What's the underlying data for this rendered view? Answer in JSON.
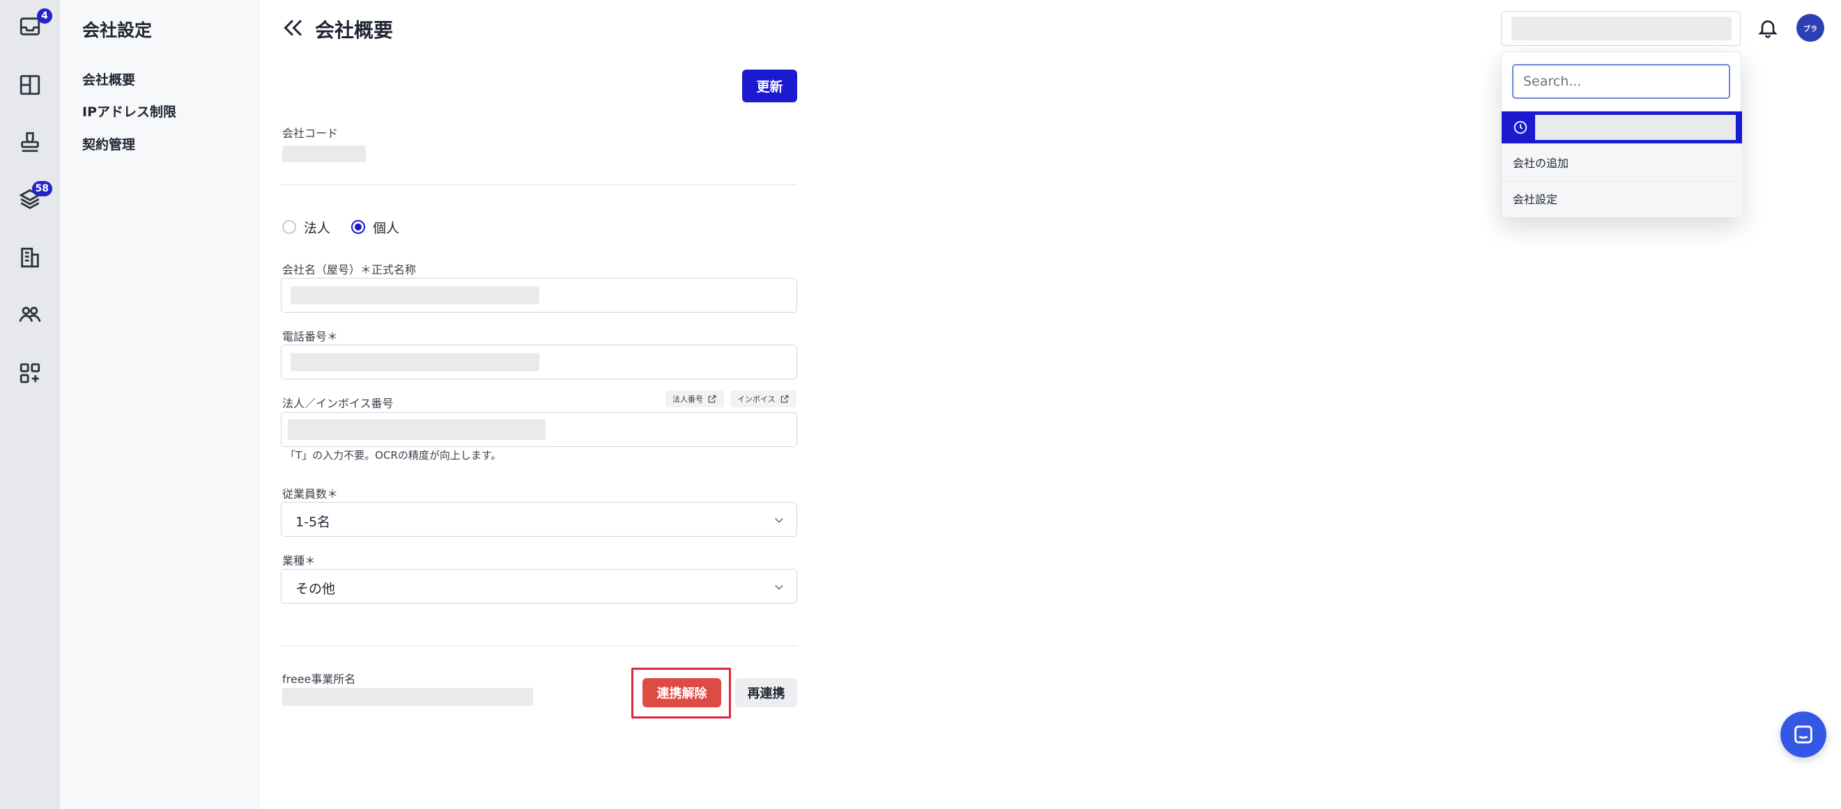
{
  "rail": {
    "inbox_badge": "4",
    "layers_badge": "58"
  },
  "sidebar": {
    "title": "会社設定",
    "items": [
      {
        "label": "会社概要"
      },
      {
        "label": "IPアドレス制限"
      },
      {
        "label": "契約管理"
      }
    ]
  },
  "header": {
    "title": "会社概要",
    "avatar_text": "ブラ"
  },
  "form": {
    "update_label": "更新",
    "company_code_label": "会社コード",
    "entity_type": {
      "options": [
        "法人",
        "個人"
      ],
      "selected": "個人"
    },
    "company_name_label": "会社名（屋号）＊正式名称",
    "phone_label": "電話番号＊",
    "invoice_label": "法人／インボイス番号",
    "corp_number_chip": "法人番号",
    "invoice_chip": "インボイス",
    "invoice_hint": "「T」の入力不要。OCRの精度が向上します。",
    "employees_label": "従業員数＊",
    "employees_value": "1-5名",
    "industry_label": "業種＊",
    "industry_value": "その他",
    "freee_label": "freee事業所名",
    "disconnect_label": "連携解除",
    "reconnect_label": "再連携"
  },
  "switcher_dropdown": {
    "search_placeholder": "Search...",
    "items": [
      {
        "label": "会社の追加"
      },
      {
        "label": "会社設定"
      }
    ]
  },
  "colors": {
    "primary": "#1a1ad0",
    "danger": "#dd4b45",
    "highlight_border": "#e0233f",
    "chat": "#3557e6"
  },
  "icons": [
    "inbox-icon",
    "columns-icon",
    "stamp-icon",
    "layers-icon",
    "building-icon",
    "users-icon",
    "apps-add-icon",
    "double-chevron-left-icon",
    "bell-icon",
    "clock-icon",
    "external-link-icon",
    "chevron-down-icon",
    "chat-icon"
  ]
}
